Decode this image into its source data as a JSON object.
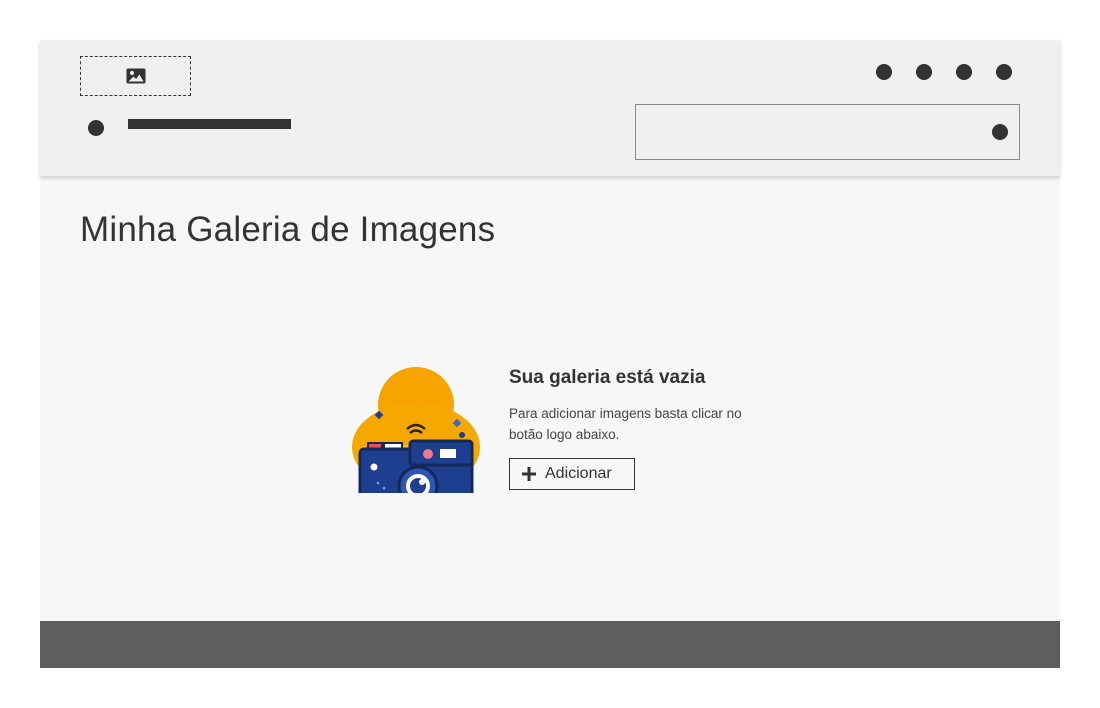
{
  "header": {
    "logo_icon": "image-icon",
    "menu_icons": [
      "menu-dot-icon",
      "menu-dot-icon",
      "menu-dot-icon",
      "menu-dot-icon"
    ]
  },
  "main": {
    "title": "Minha Galeria de Imagens",
    "empty_state": {
      "illustration": "camera-illustration",
      "heading": "Sua galeria está vazia",
      "description": "Para adicionar imagens basta clicar no botão logo abaixo.",
      "button_label": "Adicionar",
      "button_icon": "plus-icon"
    }
  },
  "colors": {
    "header_bg": "#f1eff0",
    "page_bg": "#f7f7f7",
    "text": "#333333",
    "footer_bg": "#5e5e5e",
    "camera_blue": "#1e3f8f",
    "illustration_orange": "#f5a800"
  }
}
